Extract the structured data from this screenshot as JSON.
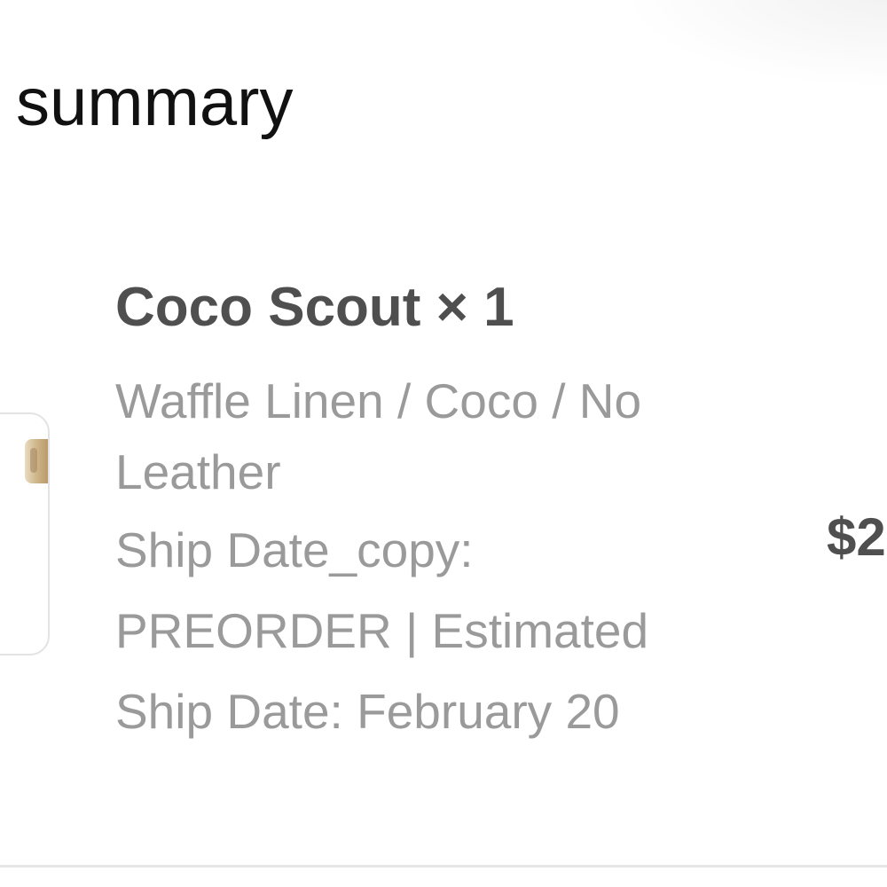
{
  "order_summary": {
    "title": "summary",
    "items": [
      {
        "name": "Coco Scout × 1",
        "variant_line1": "Waffle Linen / Coco / No",
        "variant_line2": "Leather",
        "ship_line1": "Ship Date_copy:",
        "ship_line2": "PREORDER | Estimated",
        "ship_line3": "Ship Date: February 20",
        "price": "$2",
        "thumbnail_icon": "product-thumbnail"
      }
    ]
  }
}
